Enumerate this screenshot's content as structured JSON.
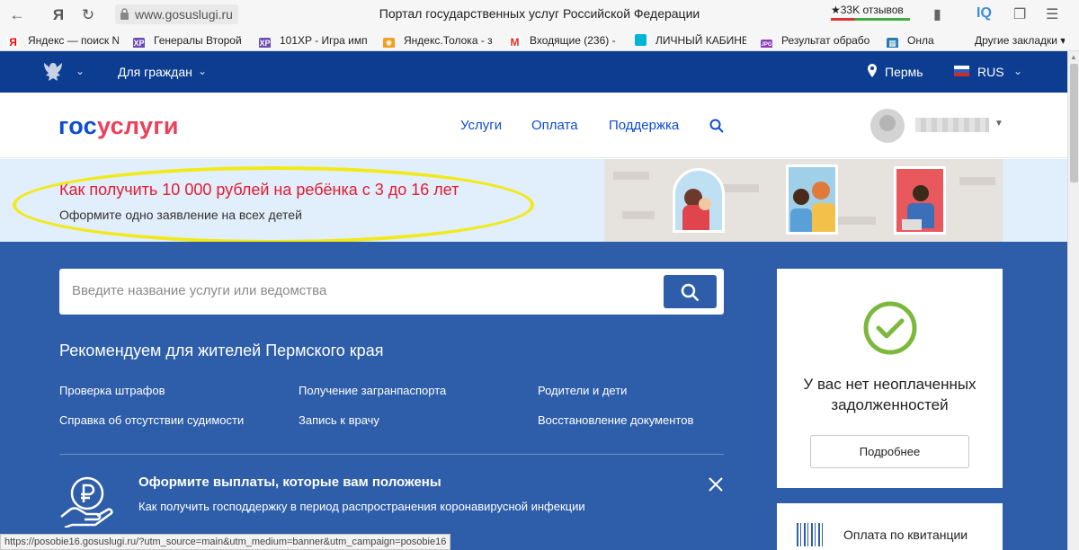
{
  "browser": {
    "url": "www.gosuslugi.ru",
    "page_title": "Портал государственных услуг Российской Федерации",
    "reviews": "★33K отзывов",
    "yandex_letter": "Я",
    "bookmarks": [
      {
        "label": "Яндекс — поиск N",
        "icon": "Я",
        "color": "#ff0000"
      },
      {
        "label": "Генералы Второй",
        "icon": "XP",
        "color": "#6a4bb0"
      },
      {
        "label": "101XP - Игра имп",
        "icon": "XP",
        "color": "#6a4bb0"
      },
      {
        "label": "Яндекс.Толока - з",
        "icon": "✺",
        "color": "#f0a020"
      },
      {
        "label": "Входящие (236) - ",
        "icon": "M",
        "color": "#d93025"
      },
      {
        "label": "ЛИЧНЫЙ КАБИНЕ",
        "icon": "",
        "color": "#00b4d8"
      },
      {
        "label": "Результат обрабо",
        "icon": "JPG",
        "color": "#8a3ab9"
      },
      {
        "label": "Онла",
        "icon": "▦",
        "color": "#2a7ab0"
      }
    ],
    "other_bookmarks": "Другие закладки",
    "status_url": "https://posobie16.gosuslugi.ru/?utm_source=main&utm_medium=banner&utm_campaign=posobie16"
  },
  "topbar": {
    "for_citizens": "Для граждан",
    "city": "Пермь",
    "lang": "RUS"
  },
  "header": {
    "logo_gos": "гос",
    "logo_uslugi": "услуги",
    "menu": [
      "Услуги",
      "Оплата",
      "Поддержка"
    ]
  },
  "banner": {
    "title": "Как получить 10 000 рублей на ребёнка с 3 до 16 лет",
    "subtitle": "Оформите одно заявление на всех детей"
  },
  "search": {
    "placeholder": "Введите название услуги или ведомства"
  },
  "recommend": {
    "title": "Рекомендуем для жителей Пермского края",
    "links": [
      "Проверка штрафов",
      "Получение загранпаспорта",
      "Родители и дети",
      "Справка об отсутствии судимости",
      "Запись к врачу",
      "Восстановление документов"
    ]
  },
  "payments": {
    "title": "Оформите выплаты, которые вам положены",
    "subtitle": "Как получить господдержку в период распространения коронавирусной инфекции"
  },
  "debt_card": {
    "text": "У вас нет неоплаченных задолженностей",
    "button": "Подробнее"
  },
  "receipt_card": {
    "label": "Оплата по квитанции"
  },
  "colors": {
    "topbar": "#0d3d91",
    "main": "#2e5ea9",
    "logo_blue": "#0d4cd3",
    "logo_red": "#ee3f58",
    "banner_title": "#e21b32",
    "check_green": "#7cb83e",
    "highlight": "#f2ea16"
  }
}
